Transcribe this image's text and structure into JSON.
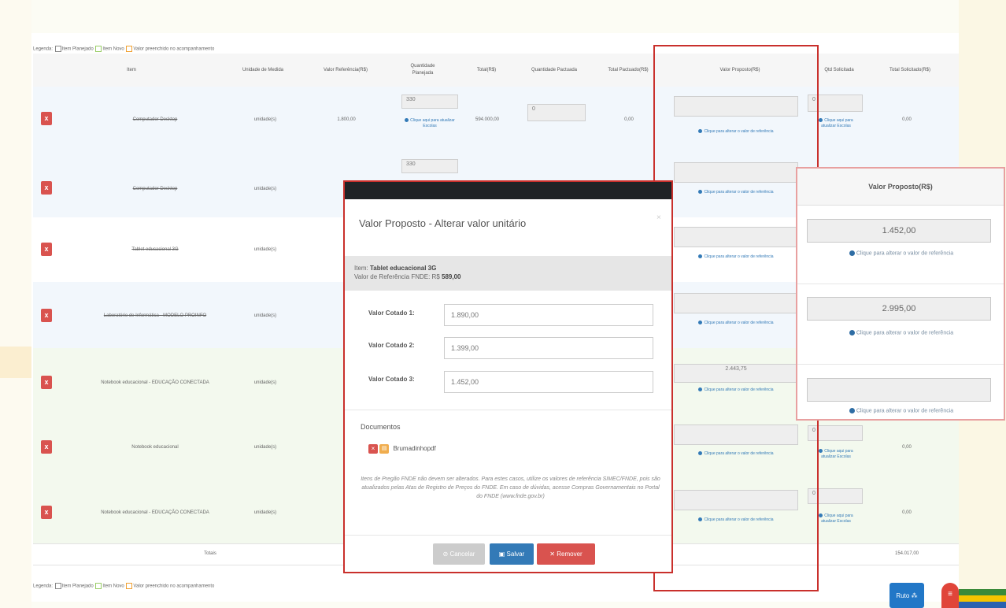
{
  "legend": {
    "label": "Legenda:",
    "items": [
      "Item Planejado",
      "Item Novo",
      "Valor preenchido no acompanhamento"
    ]
  },
  "table": {
    "headers": {
      "item": "Item",
      "unidade": "Unidade de Medida",
      "valor_ref": "Valor Referência(R$)",
      "qtd_planejada": "Quantidade Planejada",
      "total": "Total(R$)",
      "qtd_pactuada": "Quantidade Pactuada",
      "total_pactuado": "Total Pactuado(R$)",
      "valor_proposto": "Valor Proposto(R$)",
      "qtd_solicitada": "Qtd Solicitada",
      "total_solicitado": "Total Solicitado(R$)"
    },
    "rows": [
      {
        "del": "x",
        "item": "Computador Desktop",
        "unidade": "unidade(s)",
        "valor_ref": "1.800,00",
        "qtd_planejada": "330",
        "qtd_hint": "Clique aqui para atualizar Escolas",
        "total": "594.000,00",
        "qtd_pactuada": "0",
        "total_pactuado": "0,00",
        "valor_proposto": "",
        "vp_hint": "Clique para alterar o valor de referência",
        "qtd_solicitada": "0",
        "qs_hint": "Clique aqui para atualizar Escolas",
        "total_solicitado": "0,00"
      },
      {
        "del": "x",
        "item": "Computador Desktop",
        "unidade": "unidade(s)",
        "qtd_planejada": "330",
        "vp_hint": "Clique para alterar o valor de referência"
      },
      {
        "del": "x",
        "item": "Tablet educacional 3G",
        "unidade": "unidade(s)",
        "vp_hint": "Clique para alterar o valor de referência"
      },
      {
        "del": "x",
        "item": "Laboratório de Informática - MODELO PROINFO",
        "unidade": "unidade(s)",
        "vp_hint": "Clique para alterar o valor de referência"
      },
      {
        "del": "x",
        "item": "Notebook educacional - EDUCAÇÃO CONECTADA",
        "unidade": "unidade(s)",
        "valor_proposto": "2.443,75",
        "vp_hint": "Clique para alterar o valor de referência"
      },
      {
        "del": "x",
        "item": "Notebook educacional",
        "unidade": "unidade(s)",
        "vp_hint": "Clique para alterar o valor de referência",
        "qtd_solicitada": "0",
        "qs_hint": "Clique aqui para atualizar Escolas",
        "total_solicitado": "0,00"
      },
      {
        "del": "x",
        "item": "Notebook educacional - EDUCAÇÃO CONECTADA",
        "unidade": "unidade(s)",
        "vp_hint": "Clique para alterar o valor de referência",
        "qtd_solicitada": "0",
        "qs_hint": "Clique aqui para atualizar Escolas",
        "total_solicitado": "0,00"
      }
    ],
    "totals": {
      "label": "Totais",
      "total_solicitado": "154.017,00"
    }
  },
  "modal": {
    "title": "Valor Proposto - Alterar valor unitário",
    "close": "×",
    "item_prefix": "Item: ",
    "item_name": "Tablet educacional 3G",
    "ref_prefix": "Valor de Referência FNDE: R$ ",
    "ref_value": "589,00",
    "fields": [
      {
        "label": "Valor Cotado 1:",
        "value": "1.890,00"
      },
      {
        "label": "Valor Cotado 2:",
        "value": "1.399,00"
      },
      {
        "label": "Valor Cotado 3:",
        "value": "1.452,00"
      }
    ],
    "documents_title": "Documentos",
    "document_name": "Brumadinhopdf",
    "notice": "Itens de Pregão FNDE não devem ser alterados. Para estes casos, utilize os valores de referência SIMEC/FNDE, pois são atualizados pelas Atas de Registro de Preços do FNDE. Em caso de dúvidas, acesse Compras Governamentais no Portal do FNDE (www.fnde.gov.br)",
    "buttons": {
      "cancel": "Cancelar",
      "save": "Salvar",
      "remove": "Remover"
    }
  },
  "zoom": {
    "header": "Valor Proposto(R$)",
    "values": [
      "1.452,00",
      "2.995,00",
      ""
    ],
    "hint": "Clique para alterar o valor de referência"
  },
  "float_button": {
    "label": "Ruto"
  },
  "colors": {
    "highlight": "#c9302c",
    "primary": "#337ab7",
    "danger": "#d9534f",
    "header_dark": "#1f2326"
  }
}
